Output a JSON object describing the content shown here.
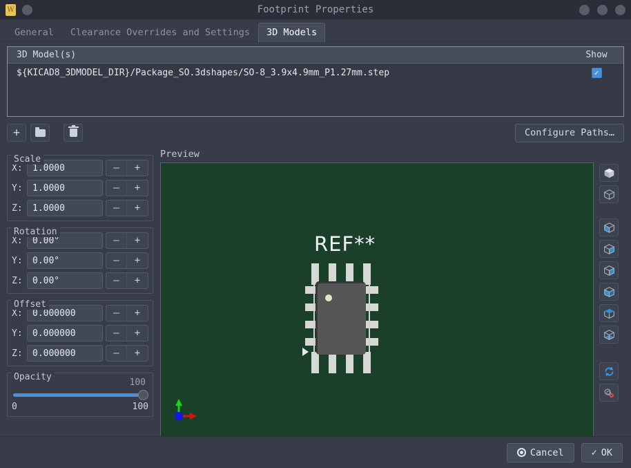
{
  "titlebar": {
    "title": "Footprint Properties",
    "app_icon": "kicad-app-icon",
    "buttons": [
      "minimize-button",
      "maximize-button",
      "close-button"
    ]
  },
  "tabs": [
    {
      "label": "General",
      "active": false
    },
    {
      "label": "Clearance Overrides and Settings",
      "active": false
    },
    {
      "label": "3D Models",
      "active": true
    }
  ],
  "model_list": {
    "col_name": "3D Model(s)",
    "col_show": "Show",
    "rows": [
      {
        "path": "${KICAD8_3DMODEL_DIR}/Package_SO.3dshapes/SO-8_3.9x4.9mm_P1.27mm.step",
        "show": true
      }
    ]
  },
  "toolbar": {
    "add_label": "+",
    "browse_label": "folder",
    "delete_label": "trash",
    "configure_paths": "Configure Paths…"
  },
  "scale": {
    "title": "Scale",
    "rows": [
      {
        "label": "X:",
        "value": "1.0000"
      },
      {
        "label": "Y:",
        "value": "1.0000"
      },
      {
        "label": "Z:",
        "value": "1.0000"
      }
    ]
  },
  "rotation": {
    "title": "Rotation",
    "rows": [
      {
        "label": "X:",
        "value": "0.00°"
      },
      {
        "label": "Y:",
        "value": "0.00°"
      },
      {
        "label": "Z:",
        "value": "0.00°"
      }
    ]
  },
  "offset": {
    "title": "Offset",
    "rows": [
      {
        "label": "X:",
        "value": "0.000000"
      },
      {
        "label": "Y:",
        "value": "0.000000"
      },
      {
        "label": "Z:",
        "value": "0.000000"
      }
    ]
  },
  "opacity": {
    "title": "Opacity",
    "value": "100",
    "min_label": "0",
    "max_label": "100",
    "accent_color": "#4a90d9"
  },
  "preview": {
    "label": "Preview",
    "board_color": "#1b4029",
    "silkscreen_text": "REF**",
    "body_color": "#565656",
    "pad_color": "#d6d8d6"
  },
  "spinner": {
    "minus": "–",
    "plus": "+"
  },
  "view_rail": {
    "buttons": [
      "view-solid-cube-icon",
      "view-wireframe-cube-icon",
      "view-left-face-icon",
      "view-right-face-icon",
      "view-front-face-icon",
      "view-back-face-icon",
      "view-top-face-icon",
      "view-bottom-face-icon",
      "reload-board-icon",
      "preview-settings-icon"
    ]
  },
  "footer": {
    "cancel": "Cancel",
    "ok": "OK",
    "ok_check": "✓"
  }
}
